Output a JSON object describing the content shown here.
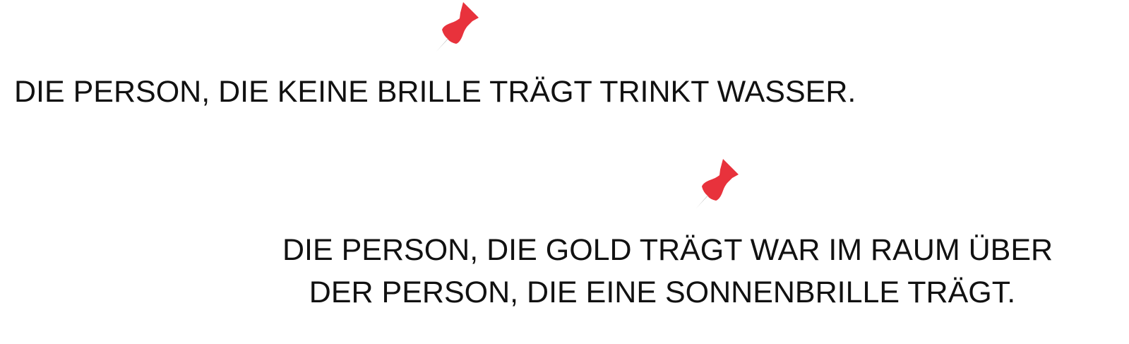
{
  "colors": {
    "pin_head": "#e8323c",
    "pin_needle": "#8e8e8e",
    "text": "#111111",
    "background": "#ffffff"
  },
  "icons": [
    "pushpin-icon",
    "pushpin-icon"
  ],
  "clues": [
    {
      "lines": [
        "DIE PERSON, DIE KEINE BRILLE TRÄGT TRINKT WASSER."
      ]
    },
    {
      "lines": [
        "DIE PERSON, DIE GOLD TRÄGT WAR IM RAUM ÜBER",
        "DER PERSON, DIE EINE SONNENBRILLE TRÄGT."
      ]
    }
  ]
}
